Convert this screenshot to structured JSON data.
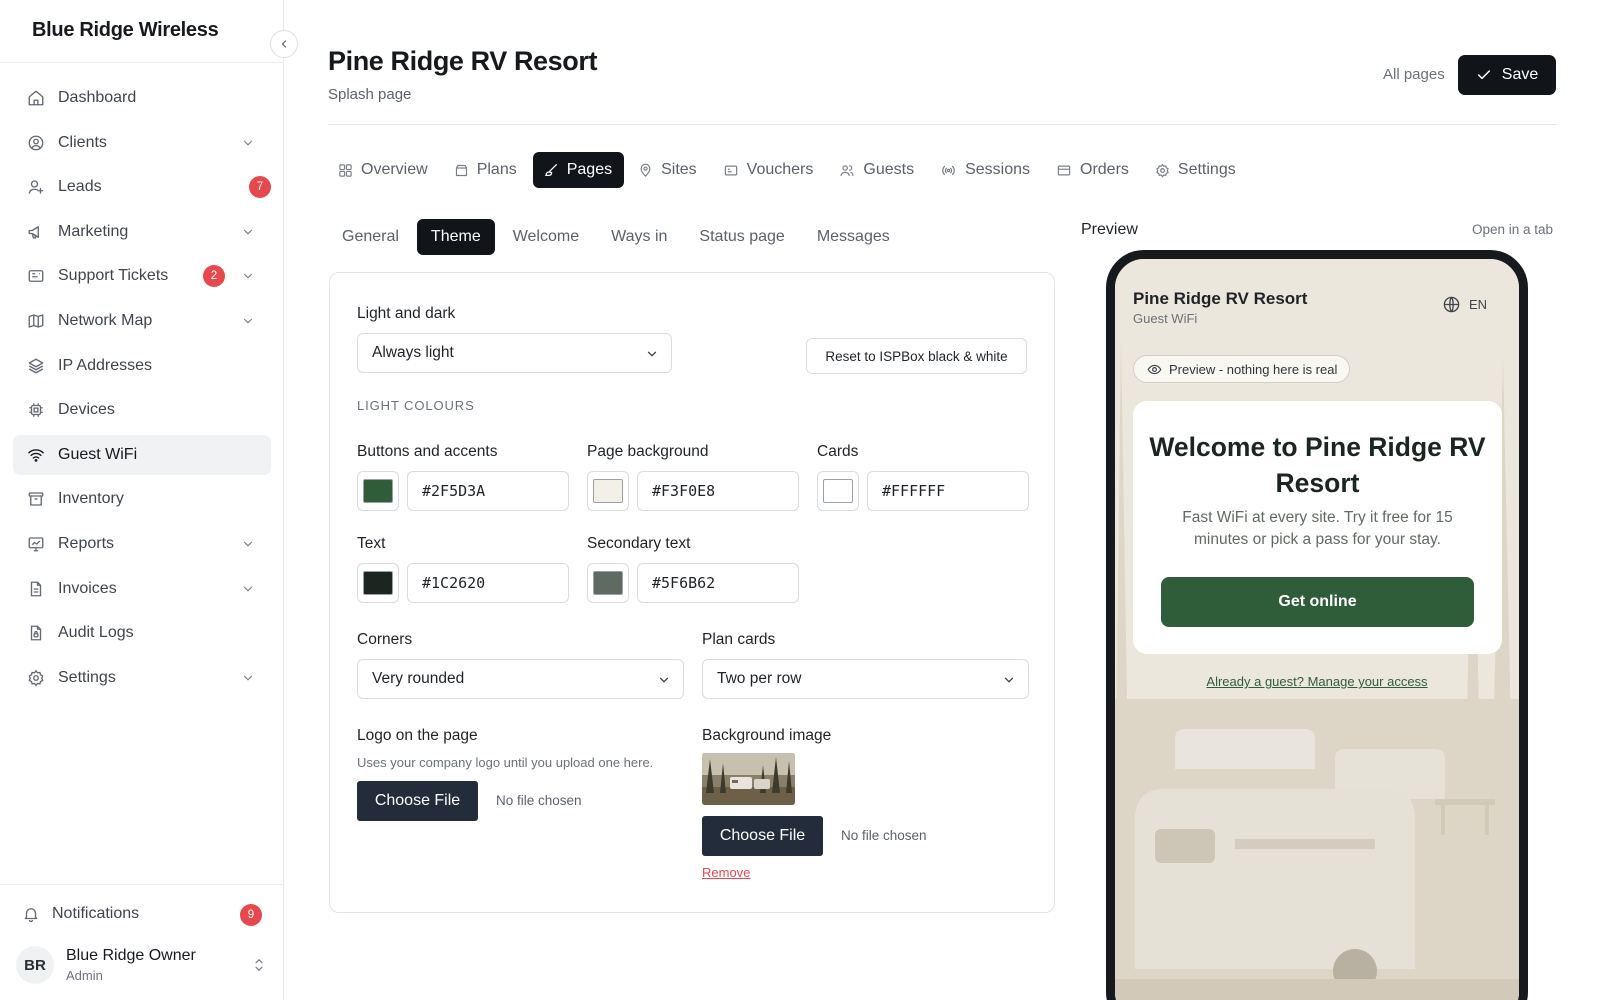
{
  "brand": {
    "name": "Blue Ridge Wireless"
  },
  "sidebar": {
    "items": [
      {
        "label": "Dashboard",
        "icon": "home-icon"
      },
      {
        "label": "Clients",
        "icon": "user-circle-icon",
        "expandable": true
      },
      {
        "label": "Leads",
        "icon": "user-plus-icon",
        "badge": "7"
      },
      {
        "label": "Marketing",
        "icon": "megaphone-icon",
        "expandable": true
      },
      {
        "label": "Support Tickets",
        "icon": "ticket-icon",
        "badge": "2",
        "expandable": true
      },
      {
        "label": "Network Map",
        "icon": "map-icon",
        "expandable": true
      },
      {
        "label": "IP Addresses",
        "icon": "layers-icon"
      },
      {
        "label": "Devices",
        "icon": "chip-icon"
      },
      {
        "label": "Guest WiFi",
        "icon": "wifi-icon",
        "active": true
      },
      {
        "label": "Inventory",
        "icon": "archive-icon"
      },
      {
        "label": "Reports",
        "icon": "chart-icon",
        "expandable": true
      },
      {
        "label": "Invoices",
        "icon": "file-icon",
        "expandable": true
      },
      {
        "label": "Audit Logs",
        "icon": "file-lock-icon"
      },
      {
        "label": "Settings",
        "icon": "gear-icon",
        "expandable": true
      }
    ],
    "notifications": {
      "label": "Notifications",
      "badge": "9"
    },
    "user": {
      "initials": "BR",
      "name": "Blue Ridge Owner",
      "role": "Admin"
    }
  },
  "header": {
    "title": "Pine Ridge RV Resort",
    "subtitle": "Splash page",
    "all_pages": "All pages",
    "save_label": "Save"
  },
  "tabs": [
    {
      "label": "Overview",
      "icon": "grid-icon"
    },
    {
      "label": "Plans",
      "icon": "box-icon"
    },
    {
      "label": "Pages",
      "icon": "brush-icon",
      "active": true
    },
    {
      "label": "Sites",
      "icon": "pin-icon"
    },
    {
      "label": "Vouchers",
      "icon": "voucher-icon"
    },
    {
      "label": "Guests",
      "icon": "users-icon"
    },
    {
      "label": "Sessions",
      "icon": "broadcast-icon"
    },
    {
      "label": "Orders",
      "icon": "card-icon"
    },
    {
      "label": "Settings",
      "icon": "gear-icon"
    }
  ],
  "subtabs": [
    {
      "label": "General"
    },
    {
      "label": "Theme",
      "active": true
    },
    {
      "label": "Welcome"
    },
    {
      "label": "Ways in"
    },
    {
      "label": "Status page"
    },
    {
      "label": "Messages"
    }
  ],
  "theme": {
    "light_dark": {
      "label": "Light and dark",
      "value": "Always light"
    },
    "reset_label": "Reset to ISPBox black & white",
    "section_title": "LIGHT COLOURS",
    "colors": {
      "buttons": {
        "label": "Buttons and accents",
        "value": "#2F5D3A"
      },
      "page_bg": {
        "label": "Page background",
        "value": "#F3F0E8"
      },
      "cards": {
        "label": "Cards",
        "value": "#FFFFFF"
      },
      "text": {
        "label": "Text",
        "value": "#1C2620"
      },
      "secondary": {
        "label": "Secondary text",
        "value": "#5F6B62"
      }
    },
    "corners": {
      "label": "Corners",
      "value": "Very rounded"
    },
    "plan_cards": {
      "label": "Plan cards",
      "value": "Two per row"
    },
    "logo": {
      "label": "Logo on the page",
      "hint": "Uses your company logo until you upload one here.",
      "button": "Choose File",
      "status": "No file chosen"
    },
    "background": {
      "label": "Background image",
      "button": "Choose File",
      "status": "No file chosen",
      "remove": "Remove"
    }
  },
  "preview": {
    "label": "Preview",
    "open_tab": "Open in a tab",
    "resort_name": "Pine Ridge RV Resort",
    "network_name": "Guest WiFi",
    "language": "EN",
    "notice": "Preview - nothing here is real",
    "welcome_title": "Welcome to Pine Ridge RV Resort",
    "welcome_text": "Fast WiFi at every site. Try it free for 15 minutes or pick a pass for your stay.",
    "cta": "Get online",
    "guest_link": "Already a guest? Manage your access"
  }
}
